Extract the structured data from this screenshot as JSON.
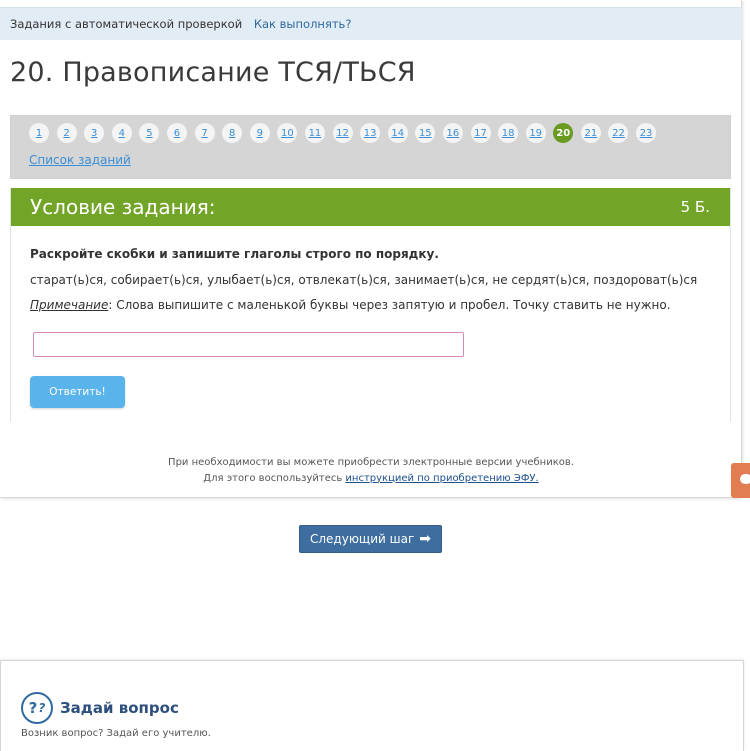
{
  "breadcrumbs": {
    "section": "Задания с автоматической проверкой",
    "how_to": "Как выполнять?"
  },
  "page_title": "20. Правописание ТСЯ/ТЬСЯ",
  "task_nav": {
    "numbers": [
      "1",
      "2",
      "3",
      "4",
      "5",
      "6",
      "7",
      "8",
      "9",
      "10",
      "11",
      "12",
      "13",
      "14",
      "15",
      "16",
      "17",
      "18",
      "19",
      "20",
      "21",
      "22",
      "23"
    ],
    "active": "20",
    "list_link": "Список заданий"
  },
  "condition": {
    "header": "Условие задания:",
    "points": "5 Б.",
    "instruction": "Раскройте скобки и запишите глаголы строго по порядку.",
    "words": "старат(ь)ся, собирает(ь)ся, улыбает(ь)ся, отвлекат(ь)ся, занимает(ь)ся, не сердят(ь)ся, поздороват(ь)ся",
    "note_label": "Примечание",
    "note_text": ": Слова выпишите с маленькой буквы через запятую и пробел. Точку ставить не нужно.",
    "answer_value": "",
    "submit_label": "Ответить!"
  },
  "footer": {
    "line1": "При необходимости вы можете приобрести электронные версии учебников.",
    "line2_prefix": "Для этого воспользуйтесь ",
    "line2_link": "инструкцией по приобретению ЭФУ."
  },
  "next_step": {
    "label": "Следующий шаг",
    "arrow": "➡"
  },
  "ask": {
    "icon_main": "?",
    "icon_small": "?",
    "title": "Задай вопрос",
    "subtitle": "Возник вопрос? Задай его учителю."
  },
  "colors": {
    "accent_green": "#72a427",
    "active_number": "#6a9a1f",
    "link_blue": "#3a8fd6",
    "submit_button": "#5ab4ec",
    "next_button": "#3e6e9f",
    "side_tab": "#e27d52",
    "breadcrumb_bg": "#e2ecf4"
  },
  "icons": {
    "side_tab": "chat-bubble-icon",
    "next_arrow": "arrow-right-icon",
    "ask": "question-circle-icon"
  }
}
